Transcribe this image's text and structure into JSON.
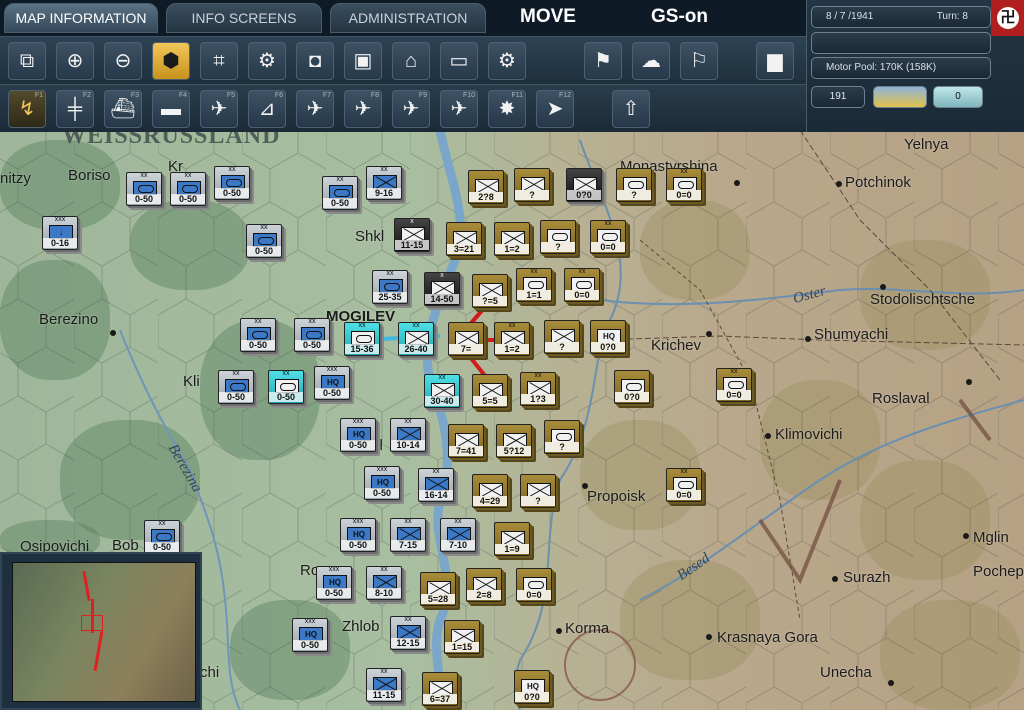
{
  "tabs": [
    {
      "label": "MAP INFORMATION",
      "active": true
    },
    {
      "label": "INFO SCREENS",
      "active": false
    },
    {
      "label": "ADMINISTRATION",
      "active": false
    }
  ],
  "mode": {
    "phase": "MOVE",
    "player": "GS-on"
  },
  "status": {
    "date": "8 / 7 /1941",
    "turn": "Turn: 8",
    "motor_pool": "Motor Pool:  170K (158K)",
    "value_box": "191",
    "toggle_label": "0"
  },
  "toolbar1": [
    {
      "name": "overlay-windows-icon"
    },
    {
      "name": "zoom-in-icon"
    },
    {
      "name": "zoom-out-icon"
    },
    {
      "name": "hex-grid-icon",
      "selected": true
    },
    {
      "name": "frame-icon"
    },
    {
      "name": "gear-icon"
    },
    {
      "name": "unit-count-icon"
    },
    {
      "name": "supply-icon"
    },
    {
      "name": "factory-icon"
    },
    {
      "name": "blank-map-icon"
    },
    {
      "name": "settings-box-icon"
    },
    {
      "name": "move-flag-icon"
    },
    {
      "name": "weather-icon"
    },
    {
      "name": "objective-flag-icon"
    },
    {
      "name": "bar-chart-icon"
    }
  ],
  "toolbar2": [
    {
      "name": "move-arrow-icon",
      "key": "F1"
    },
    {
      "name": "rail-icon",
      "key": "F2"
    },
    {
      "name": "naval-icon",
      "key": "F3"
    },
    {
      "name": "sea-transport-icon",
      "key": "F4"
    },
    {
      "name": "air-strike-icon",
      "key": "F5"
    },
    {
      "name": "artillery-icon",
      "key": "F6"
    },
    {
      "name": "air-mission-icon",
      "key": "F7"
    },
    {
      "name": "bomber-icon",
      "key": "F8"
    },
    {
      "name": "airdrop-icon",
      "key": "F9"
    },
    {
      "name": "air-transfer-icon",
      "key": "F10"
    },
    {
      "name": "explosion-icon",
      "key": "F11"
    },
    {
      "name": "next-unit-icon",
      "key": "F12"
    },
    {
      "name": "upload-icon",
      "key": ""
    }
  ],
  "map": {
    "region_label": "WEISSRUSSLAND",
    "cities": [
      {
        "name": "Yelnya"
      },
      {
        "name": "Potchinok"
      },
      {
        "name": "Stodolischtsche"
      },
      {
        "name": "Shumyachi"
      },
      {
        "name": "Krichev"
      },
      {
        "name": "Roslaval"
      },
      {
        "name": "Klimovichi"
      },
      {
        "name": "Propoisk"
      },
      {
        "name": "Mglin"
      },
      {
        "name": "Pochep"
      },
      {
        "name": "Surazh"
      },
      {
        "name": "Krasnaya Gora"
      },
      {
        "name": "Unecha"
      },
      {
        "name": "Korma"
      },
      {
        "name": "Berezino"
      },
      {
        "name": "Boriso"
      },
      {
        "name": "nitzy"
      },
      {
        "name": "Osipovichi"
      },
      {
        "name": "Bob"
      },
      {
        "name": "Zhlob"
      },
      {
        "name": "Ro"
      },
      {
        "name": "Kli"
      },
      {
        "name": "Shkl"
      },
      {
        "name": "MOGILEV"
      },
      {
        "name": "Monastyrshina"
      },
      {
        "name": "Kr"
      },
      {
        "name": "chi"
      },
      {
        "name": "kl"
      }
    ],
    "rivers": [
      {
        "name": "Berezina"
      },
      {
        "name": "Oster"
      },
      {
        "name": "Besed"
      }
    ],
    "units": [
      {
        "s": "0-50"
      },
      {
        "s": "0-50"
      },
      {
        "s": "0-50"
      },
      {
        "s": "9-16"
      },
      {
        "s": "0-16"
      },
      {
        "s": "0-50"
      },
      {
        "s": "11-15"
      },
      {
        "s": "25-35"
      },
      {
        "s": "14-50"
      },
      {
        "s": "0-50"
      },
      {
        "s": "0-50"
      },
      {
        "s": "15-36"
      },
      {
        "s": "26-40"
      },
      {
        "s": "0-50"
      },
      {
        "s": "0-50"
      },
      {
        "s": "0-50"
      },
      {
        "s": "30-40"
      },
      {
        "s": "0-50"
      },
      {
        "s": "10-14"
      },
      {
        "s": "0-50"
      },
      {
        "s": "16-14"
      },
      {
        "s": "0-50"
      },
      {
        "s": "7-15"
      },
      {
        "s": "7-10"
      },
      {
        "s": "0-50"
      },
      {
        "s": "8-10"
      },
      {
        "s": "0-50"
      },
      {
        "s": "12-15"
      },
      {
        "s": "11-15"
      },
      {
        "s": "2?8"
      },
      {
        "s": "?"
      },
      {
        "s": "0?0"
      },
      {
        "s": "?"
      },
      {
        "s": "0=0"
      },
      {
        "s": "3=21"
      },
      {
        "s": "1=2"
      },
      {
        "s": "?"
      },
      {
        "s": "0=0"
      },
      {
        "s": "?=5"
      },
      {
        "s": "1=1"
      },
      {
        "s": "0=0"
      },
      {
        "s": "7="
      },
      {
        "s": "1=2"
      },
      {
        "s": "?"
      },
      {
        "s": "0?0"
      },
      {
        "s": "5=5"
      },
      {
        "s": "1?3"
      },
      {
        "s": "0?0"
      },
      {
        "s": "0=0"
      },
      {
        "s": "7=41"
      },
      {
        "s": "5?12"
      },
      {
        "s": "?"
      },
      {
        "s": "4=29"
      },
      {
        "s": "?"
      },
      {
        "s": "0=0"
      },
      {
        "s": "1=9"
      },
      {
        "s": "5=28"
      },
      {
        "s": "2=8"
      },
      {
        "s": "0=0"
      },
      {
        "s": "1=15"
      },
      {
        "s": "6=37"
      },
      {
        "s": "0?0"
      }
    ]
  },
  "minimap": {
    "label": ""
  },
  "colors": {
    "soviet": "#9a7d30",
    "german": "#b7c0c7",
    "front": "#e02020",
    "accent": "#f1c75a"
  }
}
